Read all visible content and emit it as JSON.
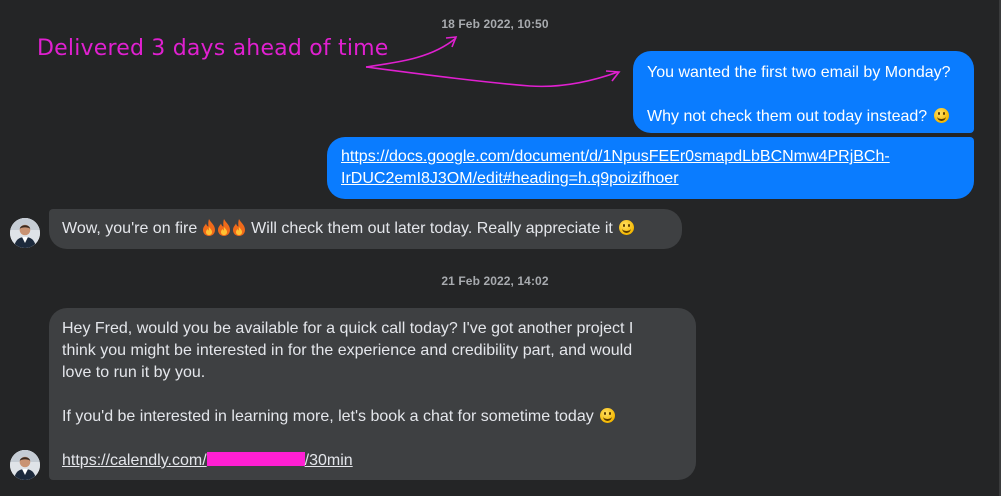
{
  "conversation": {
    "timestamp_1": "18 Feb 2022, 10:50",
    "timestamp_2": "21 Feb 2022, 14:02",
    "messages": [
      {
        "direction": "outgoing",
        "lines": [
          "You wanted the first two email by Monday?",
          "",
          "Why not check them out today instead?"
        ],
        "trailing_emoji": "smile-emoji"
      },
      {
        "direction": "outgoing",
        "link_lines": [
          "https://docs.google.com/document/d/1NpusFEEr0smapdLbBCNmw4PRjBCh-",
          "IrDUC2emI8J3OM/edit#heading=h.q9poizifhoer"
        ]
      },
      {
        "direction": "incoming",
        "text_before": "Wow, you're on fire",
        "fire_emoji_count": 3,
        "text_after": "Will check them out later today. Really appreciate it",
        "trailing_emoji": "smile-emoji"
      },
      {
        "direction": "incoming",
        "lines": [
          "Hey Fred, would you be available for a quick call today? I've got another project I",
          "think you might be interested in for the experience and credibility part, and would",
          "love to run it by you.",
          "",
          "If you'd be interested in learning more, let's book a chat for sometime today"
        ],
        "link_prefix": "https://calendly.com/",
        "link_suffix": "/30min",
        "redacted": true
      }
    ]
  },
  "annotation": {
    "text": "Delivered 3 days ahead of time",
    "color": "#e020d0"
  },
  "colors": {
    "background": "#242526",
    "outgoing_bubble": "#0a7cff",
    "incoming_bubble": "#3e4042",
    "redaction": "#ff1fd3"
  },
  "icons": [
    "smile-emoji",
    "fire-emoji",
    "avatar"
  ]
}
